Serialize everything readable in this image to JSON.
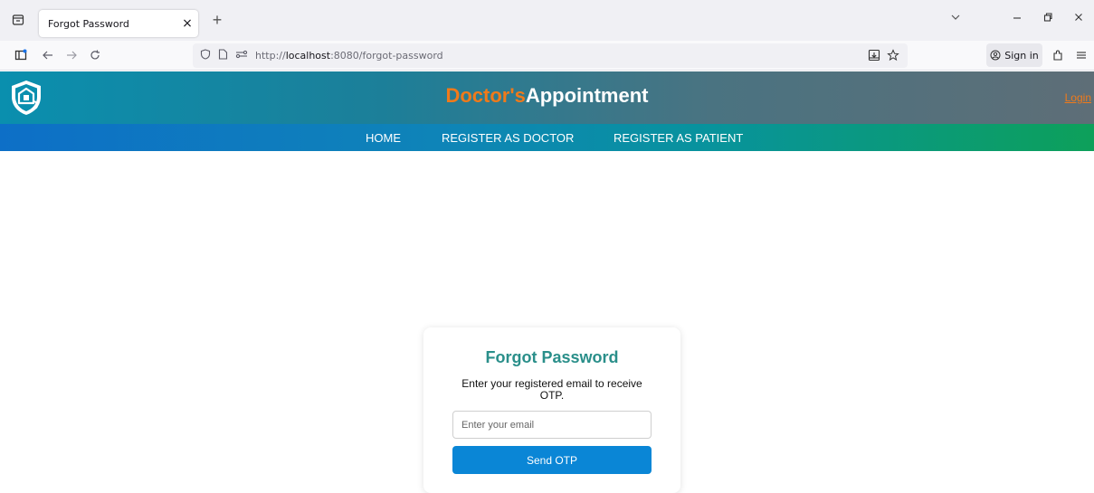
{
  "browser": {
    "tab_title": "Forgot Password",
    "tab_close": "×",
    "new_tab": "+",
    "url_prefix": "http://",
    "url_host": "localhost",
    "url_rest": ":8080/forgot-password",
    "signin_label": "Sign in"
  },
  "header": {
    "brand_part1": "Doctor's",
    "brand_part2": "Appointment",
    "login_label": "Login"
  },
  "nav": {
    "items": [
      {
        "label": "HOME"
      },
      {
        "label": "REGISTER AS DOCTOR"
      },
      {
        "label": "REGISTER AS PATIENT"
      }
    ]
  },
  "card": {
    "title": "Forgot Password",
    "description": "Enter your registered email to receive OTP.",
    "email_placeholder": "Enter your email",
    "email_value": "",
    "submit_label": "Send OTP"
  },
  "colors": {
    "accent_orange": "#f07a1a",
    "title_teal": "#2a8f8a",
    "button_blue": "#0a86d6"
  }
}
